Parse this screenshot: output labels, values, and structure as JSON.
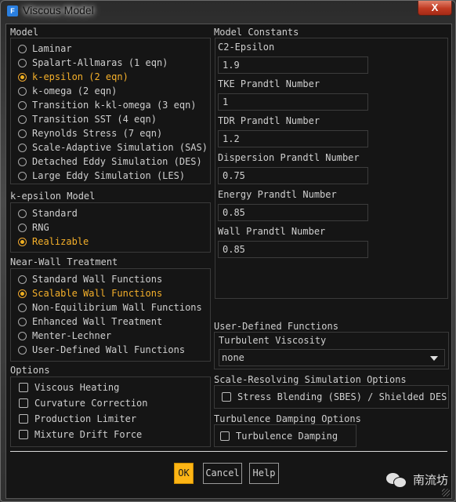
{
  "window": {
    "title": "Viscous Model",
    "app_icon_letter": "F",
    "close_glyph": "X"
  },
  "model": {
    "label": "Model",
    "options": [
      {
        "label": "Laminar",
        "selected": false
      },
      {
        "label": "Spalart-Allmaras (1 eqn)",
        "selected": false
      },
      {
        "label": "k-epsilon (2 eqn)",
        "selected": true
      },
      {
        "label": "k-omega (2 eqn)",
        "selected": false
      },
      {
        "label": "Transition k-kl-omega (3 eqn)",
        "selected": false
      },
      {
        "label": "Transition SST (4 eqn)",
        "selected": false
      },
      {
        "label": "Reynolds Stress (7 eqn)",
        "selected": false
      },
      {
        "label": "Scale-Adaptive Simulation (SAS)",
        "selected": false
      },
      {
        "label": "Detached Eddy Simulation (DES)",
        "selected": false
      },
      {
        "label": "Large Eddy Simulation (LES)",
        "selected": false
      }
    ]
  },
  "ke_model": {
    "label": "k-epsilon Model",
    "options": [
      {
        "label": "Standard",
        "selected": false
      },
      {
        "label": "RNG",
        "selected": false
      },
      {
        "label": "Realizable",
        "selected": true
      }
    ]
  },
  "near_wall": {
    "label": "Near-Wall Treatment",
    "options": [
      {
        "label": "Standard Wall Functions",
        "selected": false
      },
      {
        "label": "Scalable Wall Functions",
        "selected": true
      },
      {
        "label": "Non-Equilibrium Wall Functions",
        "selected": false
      },
      {
        "label": "Enhanced Wall Treatment",
        "selected": false
      },
      {
        "label": "Menter-Lechner",
        "selected": false
      },
      {
        "label": "User-Defined Wall Functions",
        "selected": false
      }
    ]
  },
  "options": {
    "label": "Options",
    "items": [
      {
        "label": "Viscous Heating",
        "checked": false
      },
      {
        "label": "Curvature Correction",
        "checked": false
      },
      {
        "label": "Production Limiter",
        "checked": false
      },
      {
        "label": "Mixture Drift Force",
        "checked": false
      }
    ]
  },
  "constants": {
    "label": "Model Constants",
    "fields": [
      {
        "label": "C2-Epsilon",
        "value": "1.9"
      },
      {
        "label": "TKE Prandtl Number",
        "value": "1"
      },
      {
        "label": "TDR Prandtl Number",
        "value": "1.2"
      },
      {
        "label": "Dispersion Prandtl Number",
        "value": "0.75"
      },
      {
        "label": "Energy Prandtl Number",
        "value": "0.85"
      },
      {
        "label": "Wall Prandtl Number",
        "value": "0.85"
      }
    ]
  },
  "udf": {
    "label": "User-Defined Functions",
    "turbulent_viscosity_label": "Turbulent Viscosity",
    "turbulent_viscosity_value": "none"
  },
  "srs": {
    "label": "Scale-Resolving Simulation Options",
    "item": {
      "label": "Stress Blending (SBES) / Shielded DES",
      "checked": false
    }
  },
  "damping": {
    "label": "Turbulence Damping Options",
    "item": {
      "label": "Turbulence Damping",
      "checked": false
    }
  },
  "buttons": {
    "ok": "OK",
    "cancel": "Cancel",
    "help": "Help"
  },
  "watermark": {
    "text": "南流坊"
  },
  "colors": {
    "accent": "#fdb515",
    "selected_text": "#f5b02a",
    "background": "#151515"
  }
}
